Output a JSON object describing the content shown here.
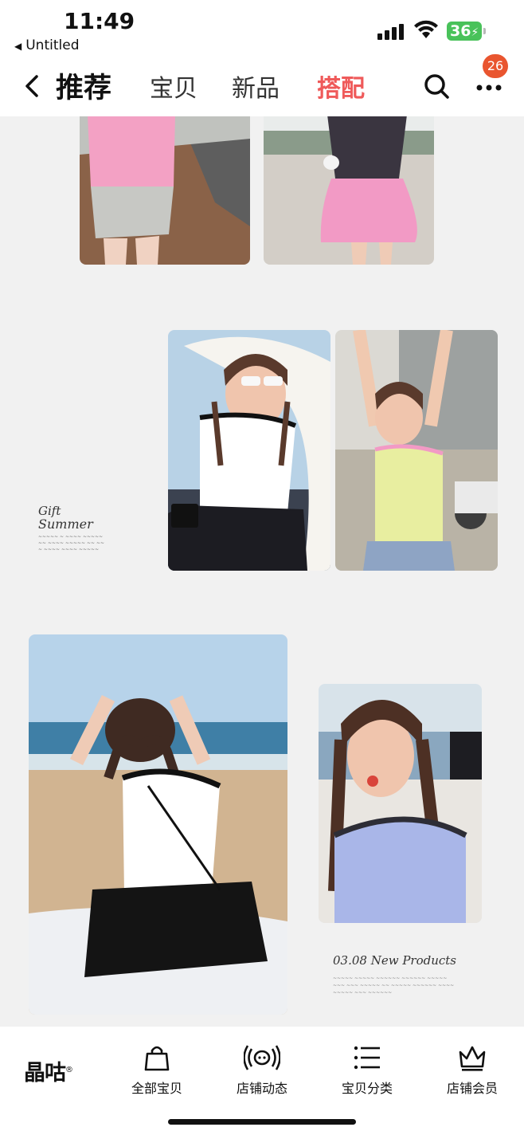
{
  "status_bar": {
    "time": "11:49",
    "back_app": "Untitled",
    "battery": "36"
  },
  "nav": {
    "tabs": [
      "推荐",
      "宝贝",
      "新品",
      "搭配"
    ],
    "active_tab": "搭配",
    "badge_count": "26"
  },
  "content": {
    "gift_title_1": "Gift",
    "gift_title_2": "Summer",
    "new_products": "03.08 New Products"
  },
  "bottom_bar": {
    "logo": "晶咕",
    "logo_mark": "®",
    "items": [
      {
        "label": "全部宝贝",
        "icon": "bag-icon"
      },
      {
        "label": "店铺动态",
        "icon": "broadcast-icon"
      },
      {
        "label": "宝贝分类",
        "icon": "list-icon"
      },
      {
        "label": "店铺会员",
        "icon": "crown-icon"
      }
    ]
  },
  "colors": {
    "accent": "#ef5a5a",
    "badge": "#e9552f",
    "battery": "#49c25a"
  }
}
